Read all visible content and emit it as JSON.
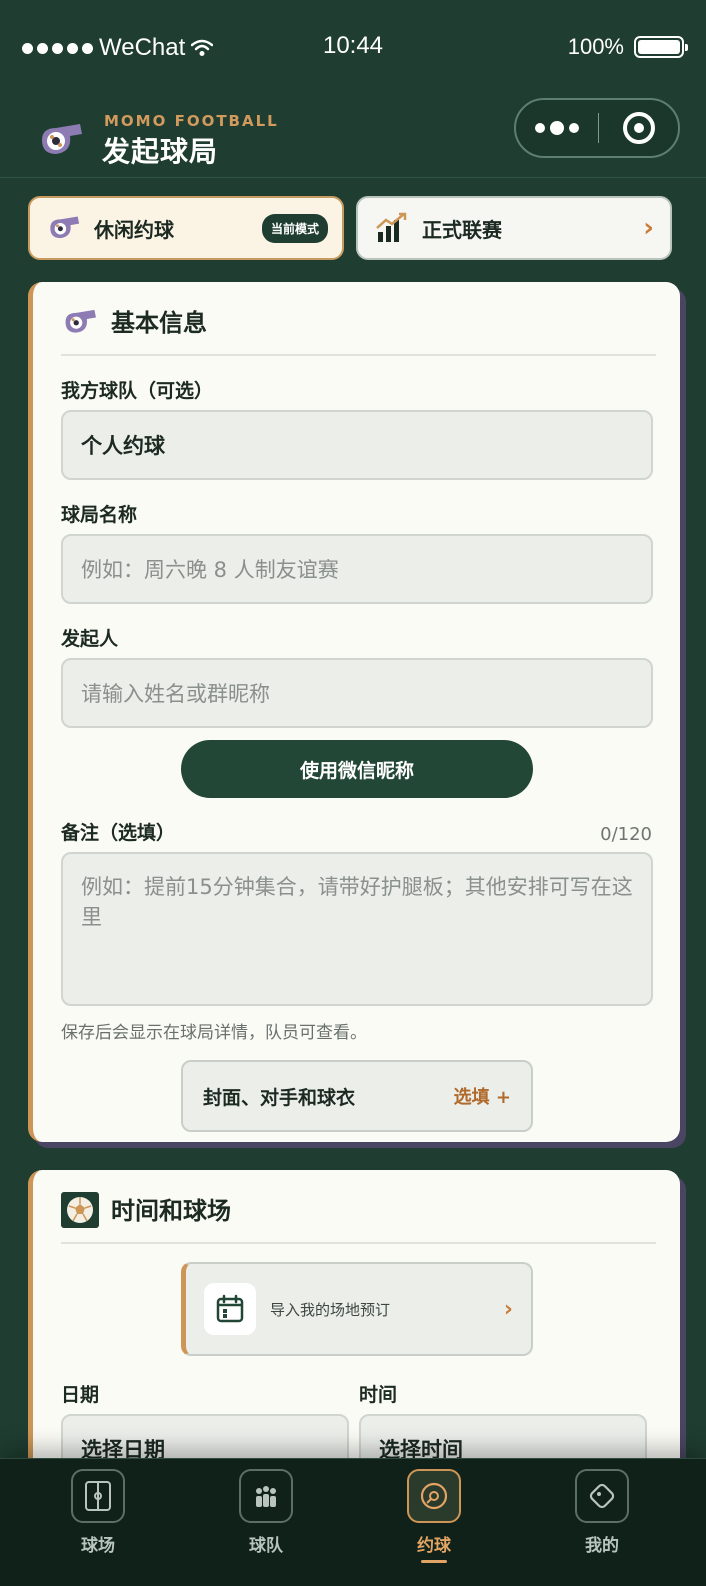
{
  "status_bar": {
    "carrier": "WeChat",
    "time": "10:44",
    "battery": "100%"
  },
  "header": {
    "brand_sub": "MOMO FOOTBALL",
    "title": "发起球局"
  },
  "modes": {
    "casual": {
      "label": "休闲约球",
      "badge": "当前模式"
    },
    "league": {
      "label": "正式联赛",
      "arrow": "›"
    }
  },
  "basic_info": {
    "title": "基本信息",
    "team_label": "我方球队（可选）",
    "team_value": "个人约球",
    "match_name_label": "球局名称",
    "match_name_placeholder": "例如：周六晚 8 人制友谊赛",
    "organizer_label": "发起人",
    "organizer_placeholder": "请输入姓名或群昵称",
    "wechat_button": "使用微信昵称",
    "note_label": "备注（选填）",
    "note_counter": "0/120",
    "note_placeholder": "例如：提前15分钟集合，请带好护腿板；其他安排可写在这里",
    "note_hint": "保存后会显示在球局详情，队员可查看。",
    "optional_button_label": "封面、对手和球衣",
    "optional_button_tag": "选填 +"
  },
  "time_venue": {
    "title": "时间和球场",
    "import_label": "导入我的场地预订",
    "import_arrow": "›",
    "date_label": "日期",
    "date_value": "选择日期",
    "time_label": "时间",
    "time_value": "选择时间"
  },
  "tab_bar": {
    "items": [
      {
        "label": "球场",
        "icon": "pitch-icon"
      },
      {
        "label": "球队",
        "icon": "team-icon"
      },
      {
        "label": "约球",
        "icon": "ball-icon",
        "active": true
      },
      {
        "label": "我的",
        "icon": "profile-icon"
      }
    ]
  },
  "colors": {
    "background": "#1f3d31",
    "accent": "#cd9656",
    "card": "#fbfbf6",
    "button": "#234737"
  }
}
